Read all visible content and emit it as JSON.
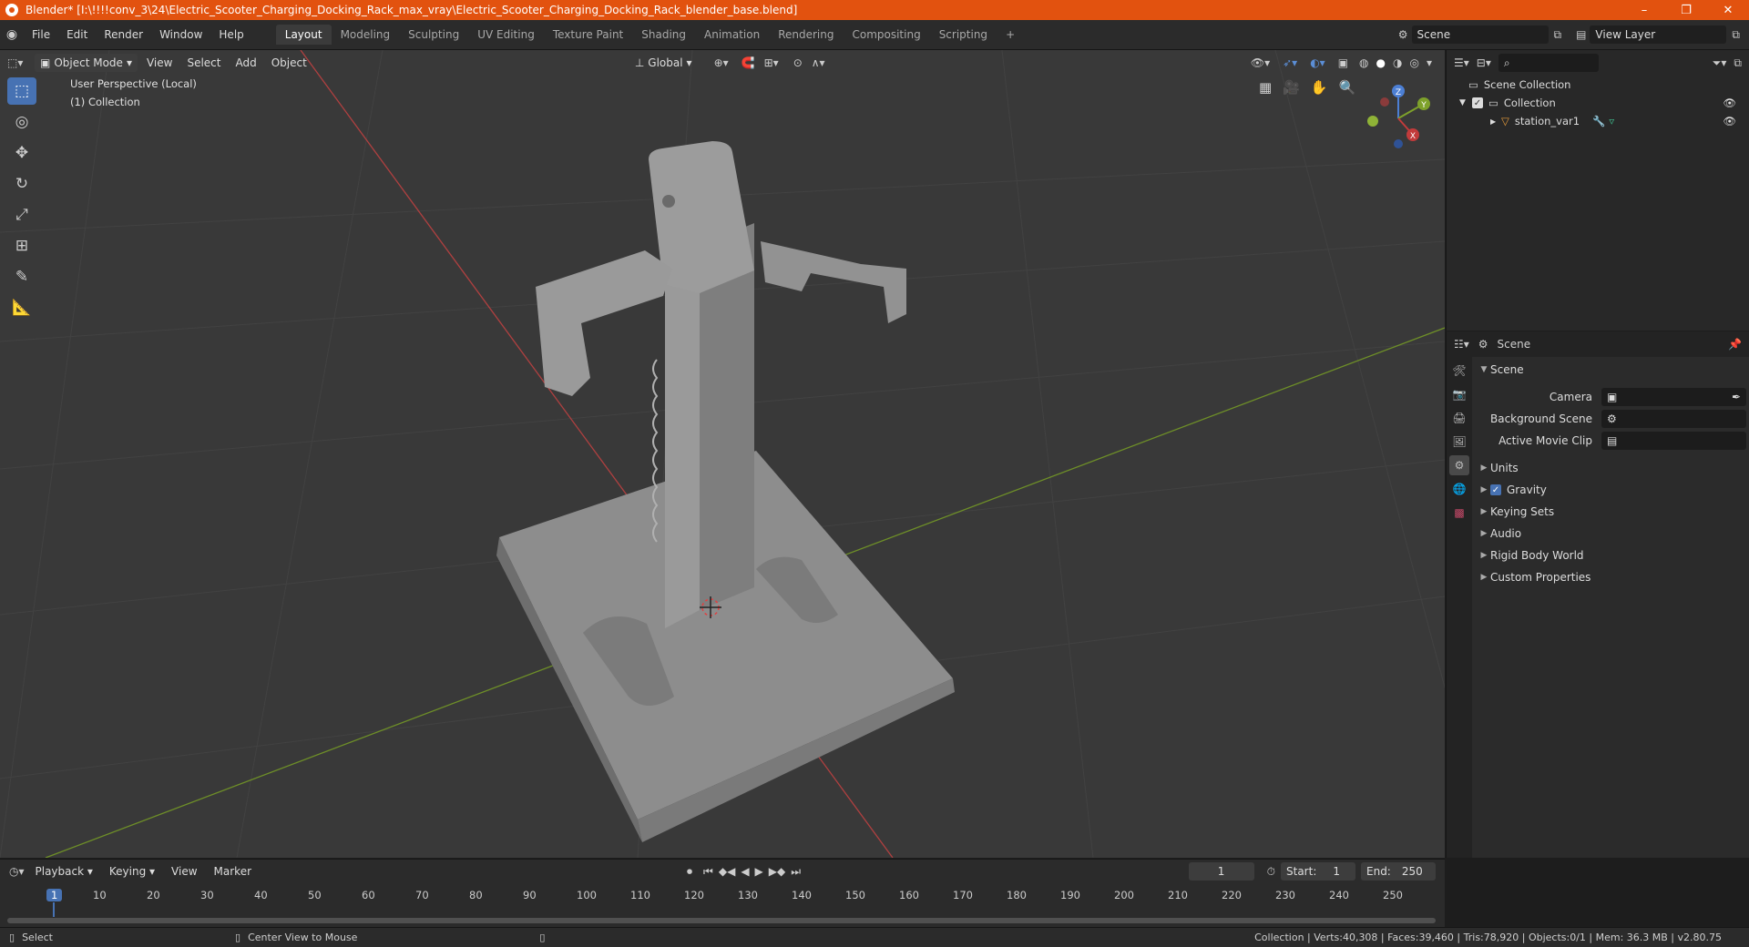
{
  "titlebar": {
    "title": "Blender* [I:\\!!!!conv_3\\24\\Electric_Scooter_Charging_Docking_Rack_max_vray\\Electric_Scooter_Charging_Docking_Rack_blender_base.blend]",
    "minimize": "–",
    "maximize": "❐",
    "close": "✕"
  },
  "menu": [
    "File",
    "Edit",
    "Render",
    "Window",
    "Help"
  ],
  "workspaces": [
    "Layout",
    "Modeling",
    "Sculpting",
    "UV Editing",
    "Texture Paint",
    "Shading",
    "Animation",
    "Rendering",
    "Compositing",
    "Scripting"
  ],
  "workspace_add": "+",
  "scene": {
    "label": "Scene",
    "view_layer": "View Layer"
  },
  "viewport": {
    "mode": "Object Mode",
    "menus": [
      "View",
      "Select",
      "Add",
      "Object"
    ],
    "transform": "Global",
    "overlay_line1": "User Perspective (Local)",
    "overlay_line2": "(1) Collection",
    "gizmo": {
      "z": "Z",
      "y": "Y",
      "x": "X"
    }
  },
  "outliner": {
    "root": "Scene Collection",
    "collection": "Collection",
    "object": "station_var1"
  },
  "properties": {
    "header": "Scene",
    "section": "Scene",
    "fields": [
      {
        "label": "Camera"
      },
      {
        "label": "Background Scene"
      },
      {
        "label": "Active Movie Clip"
      }
    ],
    "panels": [
      "Units",
      "Gravity",
      "Keying Sets",
      "Audio",
      "Rigid Body World",
      "Custom Properties"
    ]
  },
  "timeline": {
    "menus": [
      "Playback",
      "Keying",
      "View",
      "Marker"
    ],
    "current_frame": "1",
    "start_label": "Start:",
    "start": "1",
    "end_label": "End:",
    "end": "250",
    "ticks": [
      "1",
      "10",
      "20",
      "30",
      "40",
      "50",
      "60",
      "70",
      "80",
      "90",
      "100",
      "110",
      "120",
      "130",
      "140",
      "150",
      "160",
      "170",
      "180",
      "190",
      "200",
      "210",
      "220",
      "230",
      "240",
      "250"
    ]
  },
  "status": {
    "left1": "Select",
    "left2": "Center View to Mouse",
    "right": "Collection | Verts:40,308 | Faces:39,460 | Tris:78,920 | Objects:0/1 | Mem: 36.3 MB | v2.80.75"
  },
  "colors": {
    "accent": "#4772b3",
    "titlebar": "#e2520f",
    "viewport": "#393939",
    "x_axis": "#c23b3b",
    "y_axis": "#7ea12b"
  }
}
